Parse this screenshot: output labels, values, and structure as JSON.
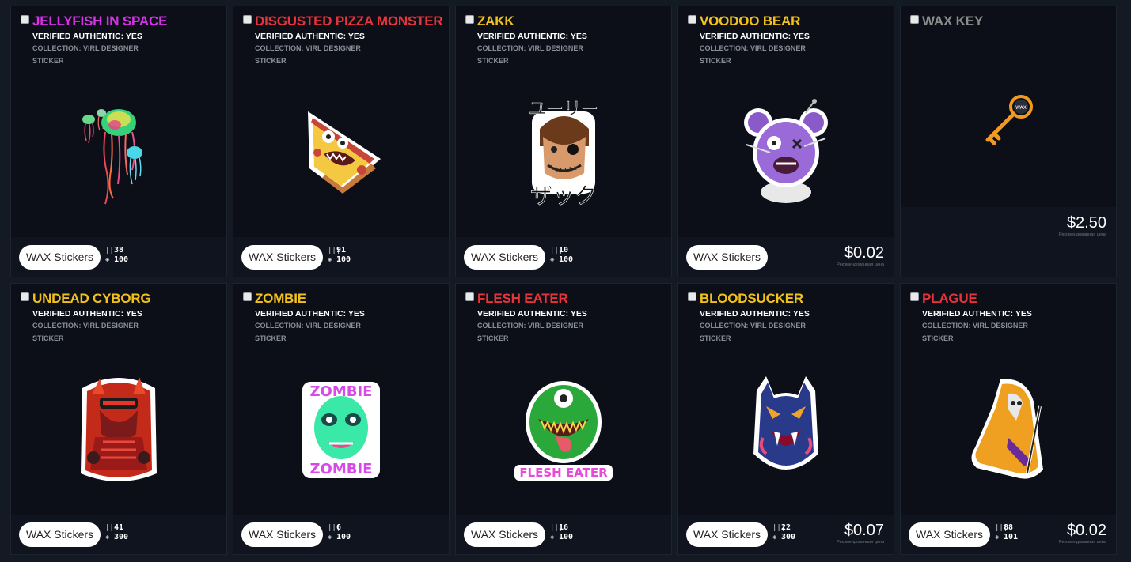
{
  "cards": [
    {
      "title": "JELLYFISH IN SPACE",
      "title_color": "#d632e8",
      "verified": "VERIFIED AUTHENTIC: YES",
      "collection": "COLLECTION: VIRL DESIGNER",
      "type": "STICKER",
      "badge": "WAX Stickers",
      "mint": "38",
      "supply": "100",
      "art_icon": "jellyfish-sticker"
    },
    {
      "title": "DISGUSTED PIZZA MONSTER",
      "title_color": "#e8333a",
      "verified": "VERIFIED AUTHENTIC: YES",
      "collection": "COLLECTION: VIRL DESIGNER",
      "type": "STICKER",
      "badge": "WAX Stickers",
      "mint": "91",
      "supply": "100",
      "art_icon": "pizza-monster-sticker"
    },
    {
      "title": "ZAKK",
      "title_color": "#f2c21a",
      "verified": "VERIFIED AUTHENTIC: YES",
      "collection": "COLLECTION: VIRL DESIGNER",
      "type": "STICKER",
      "badge": "WAX Stickers",
      "mint": "10",
      "supply": "100",
      "art_icon": "zakk-sticker",
      "art_text_top": "ユーリー",
      "art_text_bottom": "ザック"
    },
    {
      "title": "VOODOO BEAR",
      "title_color": "#f2c21a",
      "verified": "VERIFIED AUTHENTIC: YES",
      "collection": "COLLECTION: VIRL DESIGNER",
      "type": "STICKER",
      "badge": "WAX Stickers",
      "price": "$0.02",
      "price_note": "Рекомендованная цена",
      "art_icon": "voodoo-bear-sticker"
    },
    {
      "title": "WAX KEY",
      "title_color": "#8c8c8c",
      "price": "$2.50",
      "price_note": "Рекомендованная цена",
      "art_icon": "wax-key",
      "art_text": "WAX"
    },
    {
      "title": "UNDEAD CYBORG",
      "title_color": "#f2c21a",
      "verified": "VERIFIED AUTHENTIC: YES",
      "collection": "COLLECTION: VIRL DESIGNER",
      "type": "STICKER",
      "badge": "WAX Stickers",
      "mint": "41",
      "supply": "300",
      "art_icon": "undead-cyborg-sticker"
    },
    {
      "title": "ZOMBIE",
      "title_color": "#f2c21a",
      "verified": "VERIFIED AUTHENTIC: YES",
      "collection": "COLLECTION: VIRL DESIGNER",
      "type": "STICKER",
      "badge": "WAX Stickers",
      "mint": "6",
      "supply": "100",
      "art_icon": "zombie-sticker",
      "art_text": "ZOMBIE"
    },
    {
      "title": "FLESH EATER",
      "title_color": "#e8333a",
      "verified": "VERIFIED AUTHENTIC: YES",
      "collection": "COLLECTION: VIRL DESIGNER",
      "type": "STICKER",
      "badge": "WAX Stickers",
      "mint": "16",
      "supply": "100",
      "art_icon": "flesh-eater-sticker",
      "art_text": "FLESH EATER"
    },
    {
      "title": "BLOODSUCKER",
      "title_color": "#f2c21a",
      "verified": "VERIFIED AUTHENTIC: YES",
      "collection": "COLLECTION: VIRL DESIGNER",
      "type": "STICKER",
      "badge": "WAX Stickers",
      "mint": "22",
      "supply": "300",
      "price": "$0.07",
      "price_note": "Рекомендованная цена",
      "art_icon": "bloodsucker-sticker"
    },
    {
      "title": "PLAGUE",
      "title_color": "#e8333a",
      "verified": "VERIFIED AUTHENTIC: YES",
      "collection": "COLLECTION: VIRL DESIGNER",
      "type": "STICKER",
      "badge": "WAX Stickers",
      "mint": "88",
      "supply": "101",
      "price": "$0.02",
      "price_note": "Рекомендованная цена",
      "art_icon": "plague-doctor-sticker"
    }
  ]
}
